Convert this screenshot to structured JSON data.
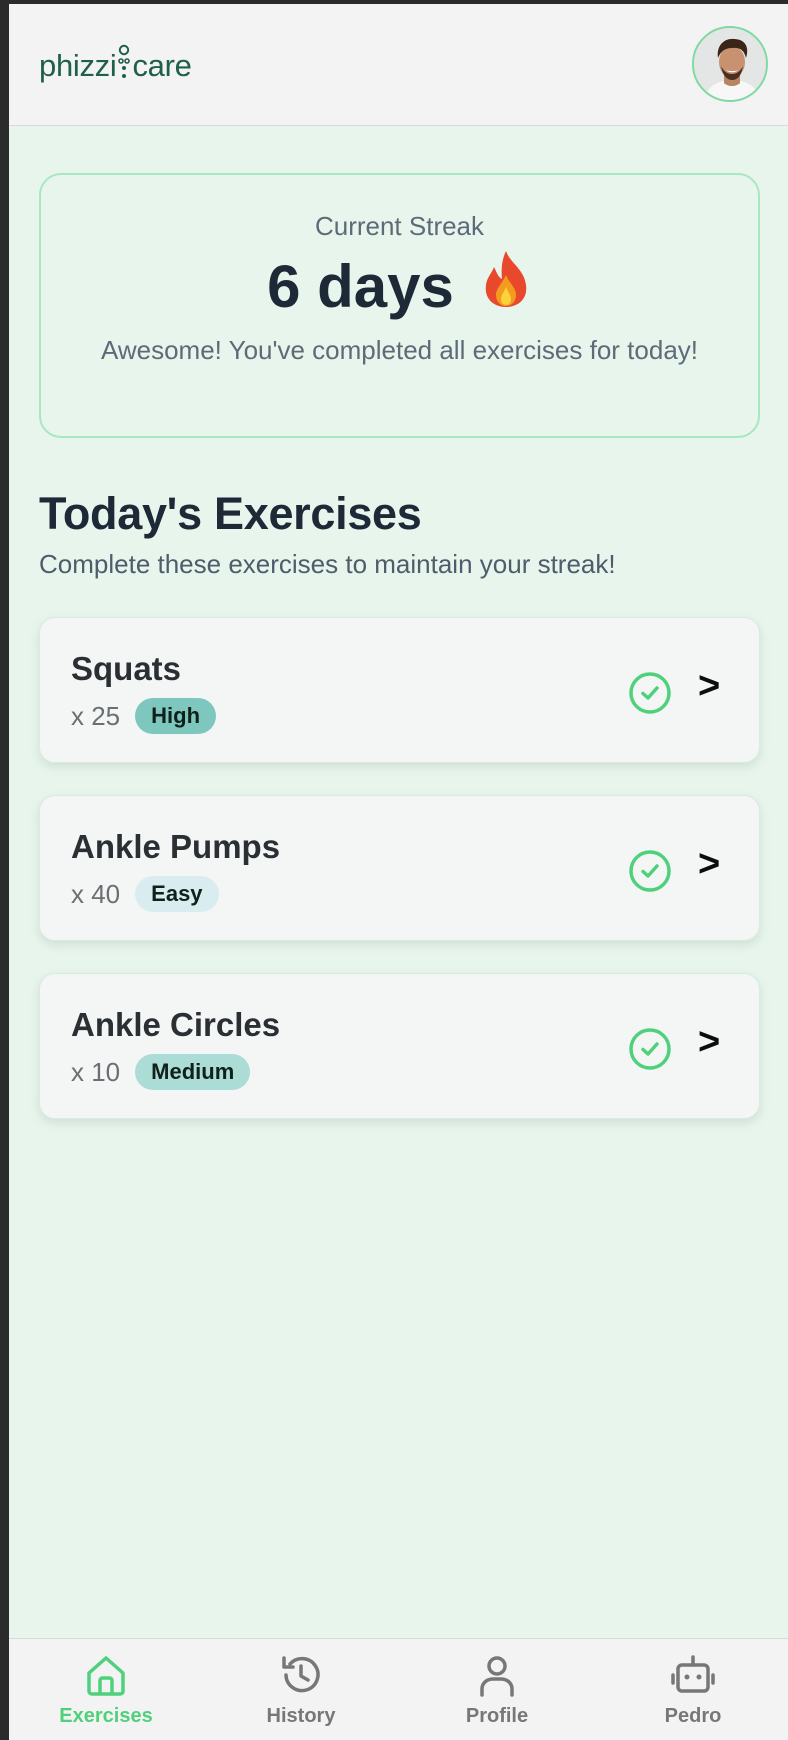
{
  "header": {
    "logo_left": "phizzi",
    "logo_right": "care",
    "avatar_icon": "user-avatar"
  },
  "streak": {
    "label": "Current Streak",
    "value": "6 days",
    "icon": "fire-icon",
    "message": "Awesome! You've completed all exercises for today!"
  },
  "section": {
    "title": "Today's Exercises",
    "subtitle": "Complete these exercises to maintain your streak!"
  },
  "exercises": [
    {
      "name": "Squats",
      "reps": "x 25",
      "level": "High",
      "completed": true,
      "chevron": ">"
    },
    {
      "name": "Ankle Pumps",
      "reps": "x 40",
      "level": "Easy",
      "completed": true,
      "chevron": ">"
    },
    {
      "name": "Ankle Circles",
      "reps": "x 10",
      "level": "Medium",
      "completed": true,
      "chevron": ">"
    }
  ],
  "nav": [
    {
      "label": "Exercises",
      "icon": "home-icon",
      "active": true
    },
    {
      "label": "History",
      "icon": "history-icon",
      "active": false
    },
    {
      "label": "Profile",
      "icon": "profile-icon",
      "active": false
    },
    {
      "label": "Pedro",
      "icon": "robot-icon",
      "active": false
    }
  ],
  "colors": {
    "accent": "#4fd17c",
    "background": "#e8f5ec",
    "brand": "#1f5f4c"
  }
}
